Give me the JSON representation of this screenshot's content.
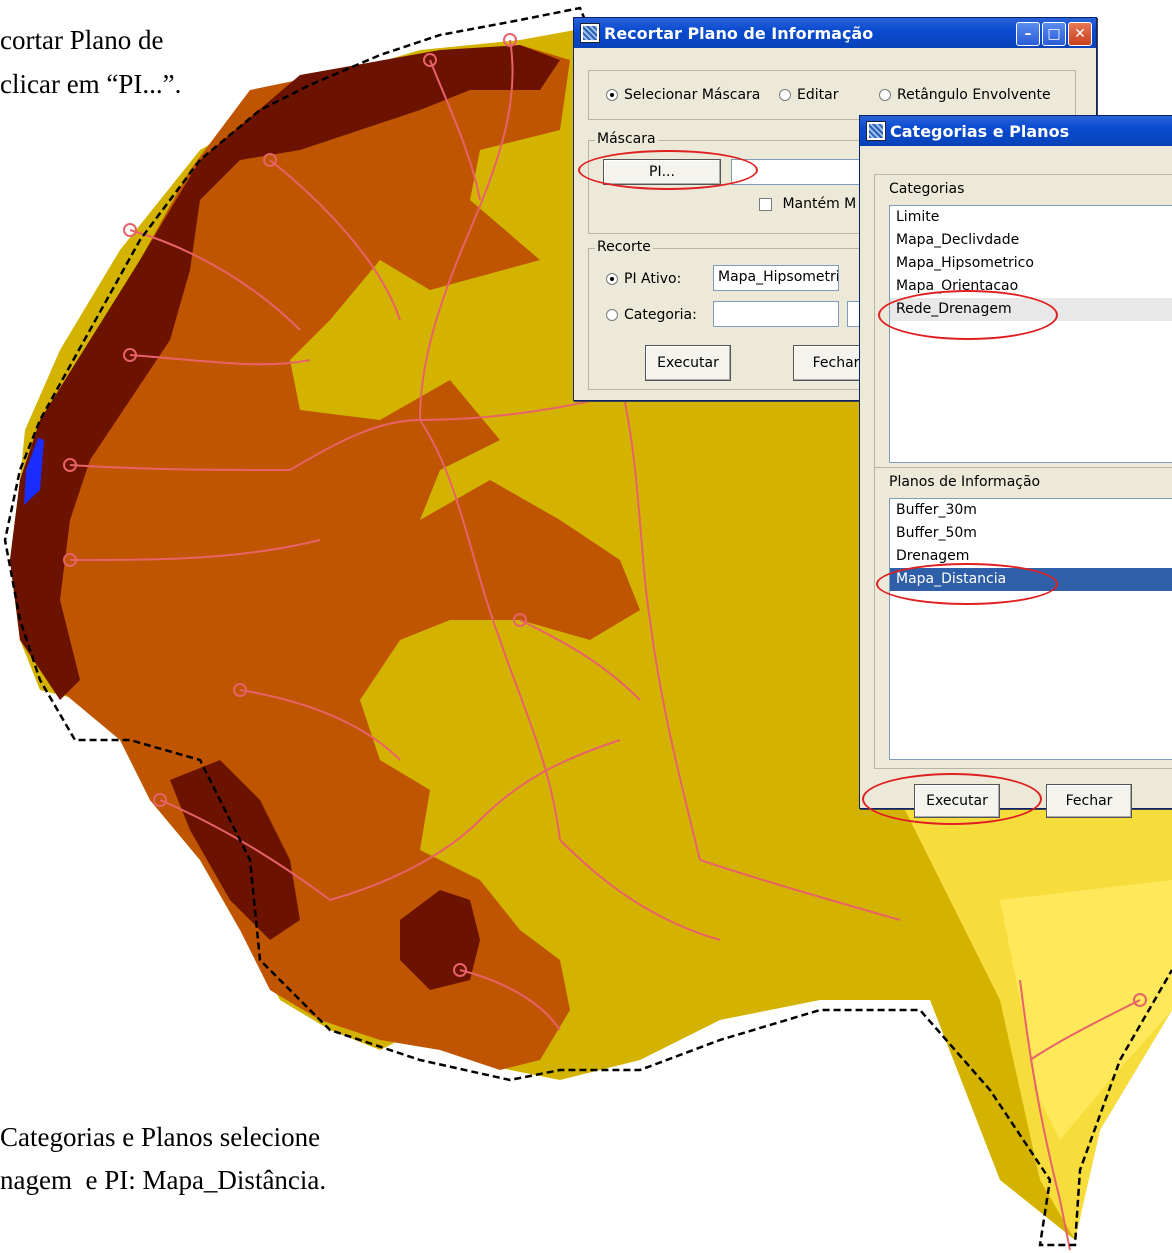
{
  "document": {
    "text_top_line1": "cortar Plano de",
    "text_top_line2": "clicar em “PI...”.",
    "text_bottom_line1": "Categorias e Planos selecione",
    "text_bottom_line2": "nagem  e PI: Mapa_Distância."
  },
  "map": {
    "colors": {
      "dark_brown": "#6B1200",
      "orange_brown": "#BF5500",
      "mustard": "#D4B300",
      "yellow": "#F7DD3C",
      "pale_yellow": "#FFE85A",
      "blue": "#1A2DFF",
      "drainage": "#E8626A"
    }
  },
  "recortar_window": {
    "title": "Recortar Plano de Informação",
    "mode_options": [
      "Selecionar Máscara",
      "Editar",
      "Retângulo Envolvente"
    ],
    "mode_selected": "Selecionar Máscara",
    "mascara": {
      "group_label": "Máscara",
      "pi_button": "PI...",
      "pi_value": "",
      "mantem_label": "Mantém M"
    },
    "recorte": {
      "group_label": "Recorte",
      "pi_ativo_label": "PI Ativo:",
      "pi_ativo_value": "Mapa_Hipsometri",
      "categoria_label": "Categoria:",
      "categoria_value": ""
    },
    "executar_button": "Executar",
    "fechar_button": "Fechar"
  },
  "categorias_window": {
    "title": "Categorias e Planos",
    "categorias_label": "Categorias",
    "categorias": [
      "Limite",
      "Mapa_Declivdade",
      "Mapa_Hipsometrico",
      "Mapa_Orientacao",
      "Rede_Drenagem"
    ],
    "categoria_selected": "Rede_Drenagem",
    "planos_label": "Planos de Informação",
    "planos": [
      "Buffer_30m",
      "Buffer_50m",
      "Drenagem",
      "Mapa_Distancia"
    ],
    "plano_selected": "Mapa_Distancia",
    "executar_button": "Executar",
    "fechar_button": "Fechar"
  },
  "annotation": {
    "highlight_color": "#E02020"
  }
}
